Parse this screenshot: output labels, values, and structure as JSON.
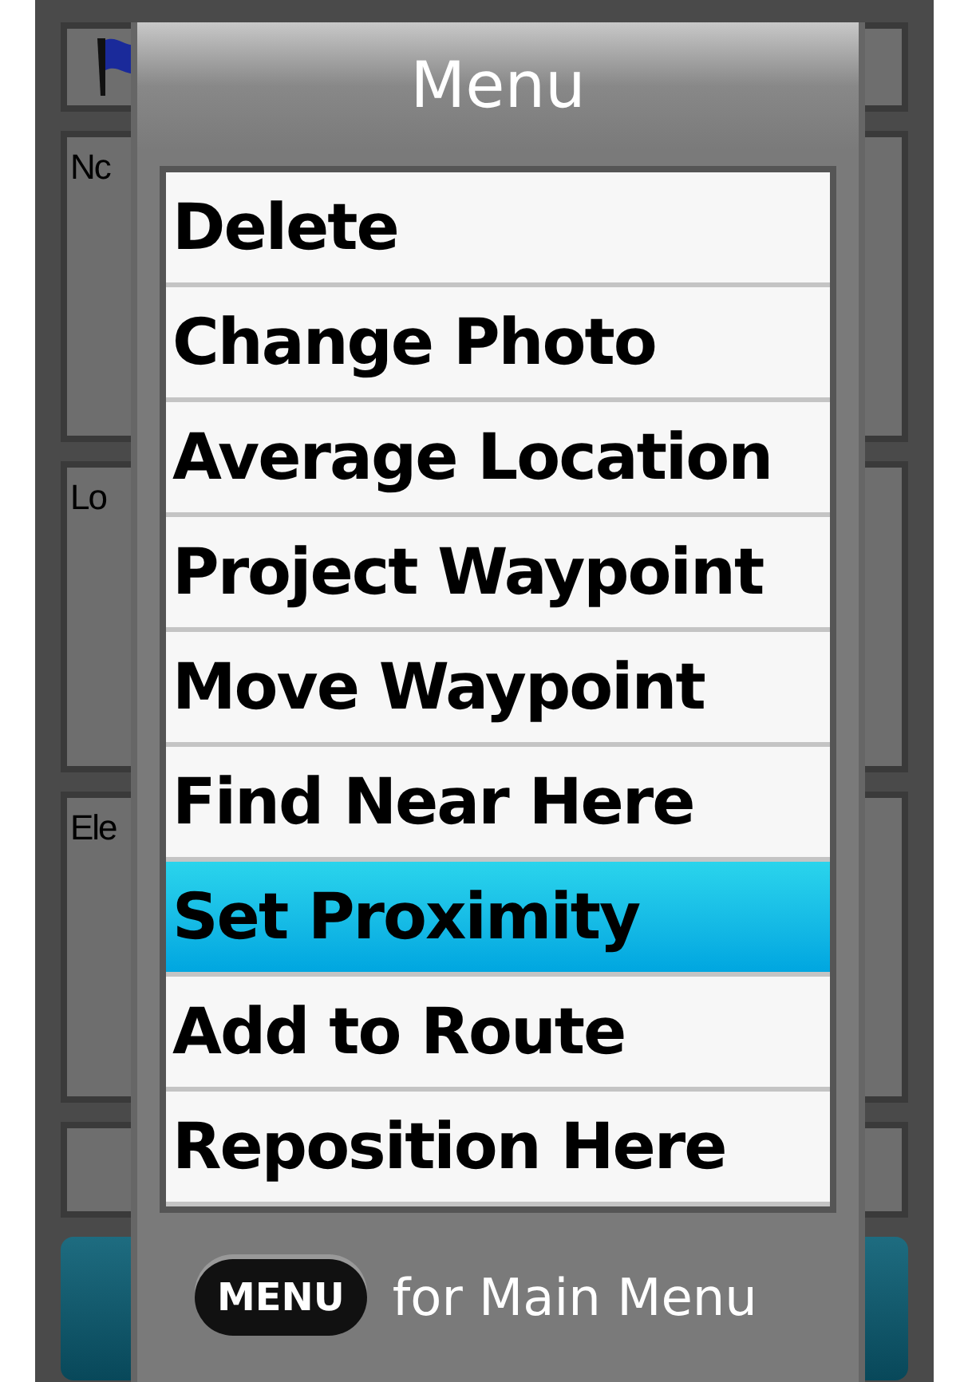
{
  "background": {
    "fields": [
      {
        "kind": "flag"
      },
      {
        "kind": "field",
        "label": "Nc"
      },
      {
        "kind": "field",
        "label": "Lo"
      },
      {
        "kind": "field",
        "label": "Ele"
      },
      {
        "kind": "blank"
      },
      {
        "kind": "button"
      }
    ]
  },
  "menu": {
    "title": "Menu",
    "items": [
      {
        "label": "Delete",
        "selected": false
      },
      {
        "label": "Change Photo",
        "selected": false
      },
      {
        "label": "Average Location",
        "selected": false
      },
      {
        "label": "Project Waypoint",
        "selected": false
      },
      {
        "label": "Move Waypoint",
        "selected": false
      },
      {
        "label": "Find Near Here",
        "selected": false
      },
      {
        "label": "Set Proximity",
        "selected": true
      },
      {
        "label": "Add to Route",
        "selected": false
      },
      {
        "label": "Reposition Here",
        "selected": false
      }
    ],
    "footer": {
      "key": "MENU",
      "text": "for Main Menu"
    }
  }
}
